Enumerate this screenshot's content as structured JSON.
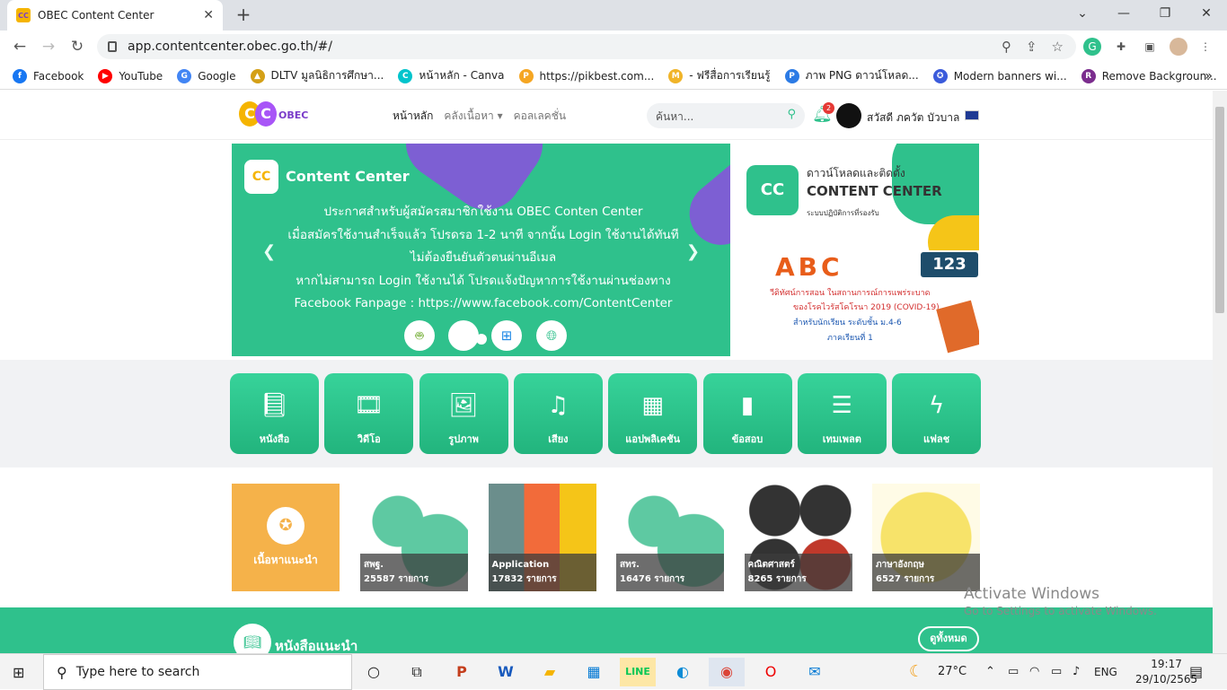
{
  "browser": {
    "tab_title": "OBEC Content Center",
    "url": "app.contentcenter.obec.go.th/#/",
    "bookmarks": [
      {
        "label": "Facebook",
        "color": "#1877f2",
        "glyph": "f"
      },
      {
        "label": "YouTube",
        "color": "#ff0000",
        "glyph": "▶"
      },
      {
        "label": "Google",
        "color": "#4285f4",
        "glyph": "G"
      },
      {
        "label": "DLTV มูลนิธิการศึกษา...",
        "color": "#d4a017",
        "glyph": "▲"
      },
      {
        "label": "หน้าหลัก - Canva",
        "color": "#00c4cc",
        "glyph": "C"
      },
      {
        "label": "https://pikbest.com...",
        "color": "#f5a623",
        "glyph": "P"
      },
      {
        "label": "- ฟรีสื่อการเรียนรู้",
        "color": "#f0b429",
        "glyph": "M"
      },
      {
        "label": "ภาพ PNG ดาวน์โหลด...",
        "color": "#2c7be5",
        "glyph": "P"
      },
      {
        "label": "Modern banners wi...",
        "color": "#3b5bdb",
        "glyph": "✪"
      },
      {
        "label": "Remove Backgroun...",
        "color": "#7b2d8e",
        "glyph": "R"
      }
    ]
  },
  "site": {
    "logo_text": "OBEC",
    "nav": [
      {
        "label": "หน้าหลัก"
      },
      {
        "label": "คลังเนื้อหา ▾"
      },
      {
        "label": "คอลเลคชั่น"
      }
    ],
    "search_placeholder": "ค้นหา...",
    "notification_count": "2",
    "user_name": "สวัสดี ภควัต บัวบาล"
  },
  "banner": {
    "title": "Content Center",
    "lines": [
      "ประกาศสำหรับผู้สมัครสมาชิกใช้งาน OBEC Conten Center",
      "เมื่อสมัครใช้งานสำเร็จแล้ว โปรดรอ 1-2 นาที จากนั้น Login ใช้งานได้ทันที",
      "ไม่ต้องยืนยันตัวตนผ่านอีเมล",
      "หากไม่สามารถ Login ใช้งานได้ โปรดแจ้งปัญหาการใช้งานผ่านช่องทาง",
      "Facebook Fanpage : https://www.facebook.com/ContentCenter"
    ]
  },
  "side_ads": {
    "ad1": {
      "line1": "ดาวน์โหลดและติดตั้ง",
      "line2": "CONTENT CENTER",
      "line3": "ระบบปฏิบัติการที่รองรับ"
    },
    "ad2": {
      "numbers": "123",
      "line1": "วีดิทัศน์การสอน ในสถานการณ์การแพร่ระบาด",
      "line2": "ของโรคไวรัสโคโรนา 2019 (COVID-19)",
      "line3": "สำหรับนักเรียน ระดับชั้น ม.4-6",
      "line4": "ภาคเรียนที่ 1"
    }
  },
  "categories": [
    {
      "label": "หนังสือ",
      "icon": "book-icon"
    },
    {
      "label": "วิดีโอ",
      "icon": "film-icon"
    },
    {
      "label": "รูปภาพ",
      "icon": "image-icon"
    },
    {
      "label": "เสียง",
      "icon": "music-icon"
    },
    {
      "label": "แอปพลิเคชัน",
      "icon": "apps-icon"
    },
    {
      "label": "ข้อสอบ",
      "icon": "file-icon"
    },
    {
      "label": "เทมเพลต",
      "icon": "list-icon"
    },
    {
      "label": "แฟลช",
      "icon": "flash-icon"
    }
  ],
  "recommended_label": "เนื้อหาแนะนำ",
  "tiles": [
    {
      "name": "สพฐ.",
      "count": "25587 รายการ"
    },
    {
      "name": "Application",
      "count": "17832 รายการ"
    },
    {
      "name": "สทร.",
      "count": "16476 รายการ"
    },
    {
      "name": "คณิตศาสตร์",
      "count": "8265 รายการ"
    },
    {
      "name": "ภาษาอังกฤษ",
      "count": "6527 รายการ"
    }
  ],
  "book_section": {
    "title": "หนังสือแนะนำ",
    "view_all": "ดูทั้งหมด"
  },
  "watermark": {
    "line1": "Activate Windows",
    "line2": "Go to Settings to activate Windows."
  },
  "taskbar": {
    "search_placeholder": "Type here to search",
    "weather": "27°C",
    "lang": "ENG",
    "time": "19:17",
    "date": "29/10/2565"
  },
  "colors": {
    "brand_green": "#2fc18c",
    "brand_purple": "#7d5fd3",
    "brand_yellow": "#f5b400"
  }
}
